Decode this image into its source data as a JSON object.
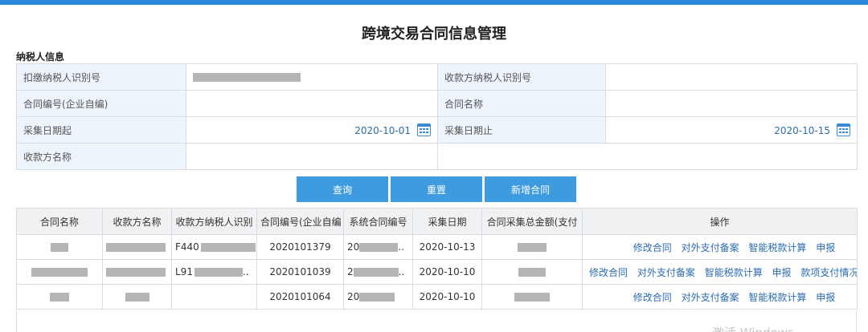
{
  "page": {
    "title": "跨境交易合同信息管理",
    "section_title": "纳税人信息"
  },
  "form": {
    "withholder_id_label": "扣缴纳税人识别号",
    "payee_id_label": "收款方纳税人识别号",
    "contract_no_label": "合同编号(企业自编)",
    "contract_name_label": "合同名称",
    "date_start_label": "采集日期起",
    "date_start_value": "2020-10-01",
    "date_end_label": "采集日期止",
    "date_end_value": "2020-10-15",
    "payee_name_label": "收款方名称"
  },
  "buttons": {
    "query": "查询",
    "reset": "重置",
    "add_contract": "新增合同"
  },
  "table": {
    "headers": [
      "合同名称",
      "收款方名称",
      "收款方纳税人识别",
      "合同编号(企业自编",
      "系统合同编号",
      "采集日期",
      "合同采集总金额(支付",
      "操作"
    ],
    "rows": [
      {
        "payee_id_prefix": "F440",
        "contract_no": "2020101379",
        "sys_no_prefix": "20",
        "sys_no_suffix": "..",
        "date": "2020-10-13",
        "ops": [
          "修改合同",
          "对外支付备案",
          "智能税款计算",
          "申报"
        ]
      },
      {
        "payee_id_prefix": "L91",
        "payee_id_suffix": "..",
        "contract_no": "2020101039",
        "sys_no_prefix": "2",
        "sys_no_suffix": "..",
        "date": "2020-10-10",
        "ops": [
          "修改合同",
          "对外支付备案",
          "智能税款计算",
          "申报",
          "款项支付情况..."
        ]
      },
      {
        "contract_no": "2020101064",
        "sys_no_prefix": "20",
        "date": "2020-10-10",
        "ops": [
          "修改合同",
          "对外支付备案",
          "智能税款计算",
          "申报"
        ]
      }
    ]
  },
  "watermark": "激活 Windows",
  "colors": {
    "accent": "#2b88d8",
    "button": "#3f9be0",
    "link": "#2b6cb0",
    "label_bg": "#eef4fb"
  }
}
